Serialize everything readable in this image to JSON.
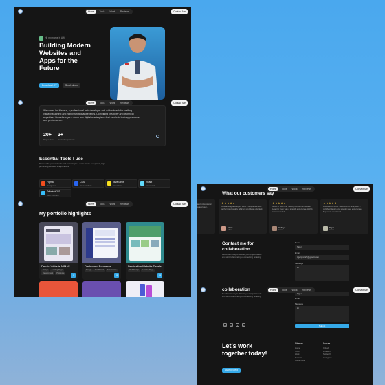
{
  "colors": {
    "accent": "#35a9e8",
    "bg": "#151515",
    "page_gradient_top": "#4aa8ee",
    "page_gradient_bottom": "#8fb2d8"
  },
  "nav": {
    "items": [
      "Home",
      "Tools",
      "Work",
      "Reviews"
    ],
    "contact_label": "Contact Me"
  },
  "hero": {
    "tagline": "Hi, my name is Alfi",
    "headline": "Building Modern Websites and Apps for the Future",
    "cta_primary": "Download CV",
    "cta_secondary": "Scroll down"
  },
  "about": {
    "paragraph": "Welcome! I'm Mazera, a professional web developer and with a knack for crafting visually stunning and highly functional websites. Combining creativity and technical expertise, I transform your vision into digital masterpiece that excels in both appearance and performance.",
    "stats": [
      {
        "value": "20+",
        "label": "Project done"
      },
      {
        "value": "2+",
        "label": "Years of experience"
      }
    ]
  },
  "tools": {
    "title": "Essential Tools I use",
    "subtitle": "Discover the powerful tools and technologies I use to create exceptional, high-performing websites & applications.",
    "items": [
      {
        "name": "Figma",
        "desc": "Design tool",
        "color": "#f24e1e",
        "icon": "figma-icon"
      },
      {
        "name": "CSS",
        "desc": "User Interface",
        "color": "#2965f1",
        "icon": "css-icon"
      },
      {
        "name": "JavaScript",
        "desc": "Interaction",
        "color": "#f7df1e",
        "icon": "javascript-icon"
      },
      {
        "name": "React",
        "desc": "Framework",
        "color": "#61dafb",
        "icon": "react-icon"
      },
      {
        "name": "TailwindCSS",
        "desc": "User Interface",
        "color": "#38bdf8",
        "icon": "tailwind-icon"
      }
    ]
  },
  "portfolio": {
    "title": "My portfolio highlights",
    "projects": [
      {
        "title": "Desain Website NIMAS",
        "tags": [
          "Design",
          "Landing Page",
          "Development",
          "Prototype"
        ]
      },
      {
        "title": "Dashboard Ecomerce",
        "tags": [
          "Design",
          "Dashboard",
          "Ecommerce"
        ]
      },
      {
        "title": "Destination Website Details",
        "tags": [
          "Web Design",
          "Landing Page"
        ]
      }
    ]
  },
  "testimonials": {
    "title": "What our customers say",
    "items": [
      {
        "text": "Outstanding and professional result. Intuitive and user-friendly.",
        "name": "",
        "role": ""
      },
      {
        "text": "Outstanding developer! Build a unique site with perfect functionality. Efficient and detail-oriented.",
        "name": "Marie",
        "role": "Client"
      },
      {
        "text": "Good to work and has a professional attitude. Leading them was a smooth experience. Highly recommended.",
        "name": "Cahaya",
        "role": "Client"
      },
      {
        "text": "Professional work. Delivered on time, with a polished design and smooth user experience. Top-notch developer!",
        "name": "Tiger",
        "role": "Client"
      }
    ]
  },
  "contact": {
    "title": "Contact me for collaboration",
    "title_short": "collaboration",
    "subtitle": "Reach out today to discuss your project needs and start collaborating on something amazing!",
    "fields": {
      "name_label": "Name",
      "name_value": "Tiger",
      "email_label": "Email",
      "email_value": "tigerpro123@gmail.com",
      "message_label": "Message",
      "message_value": "Hi"
    },
    "submit_label": "Submit"
  },
  "footer": {
    "headline": "Let's work together today!",
    "cta": "Start project",
    "sitemap_title": "Sitemap",
    "sitemap": [
      "Home",
      "Tools",
      "Work",
      "Reviews",
      "Contact Me"
    ],
    "socials_title": "Socials",
    "socials": [
      "GitHub",
      "LinkedIn",
      "Twitter X",
      "Instagram"
    ]
  }
}
